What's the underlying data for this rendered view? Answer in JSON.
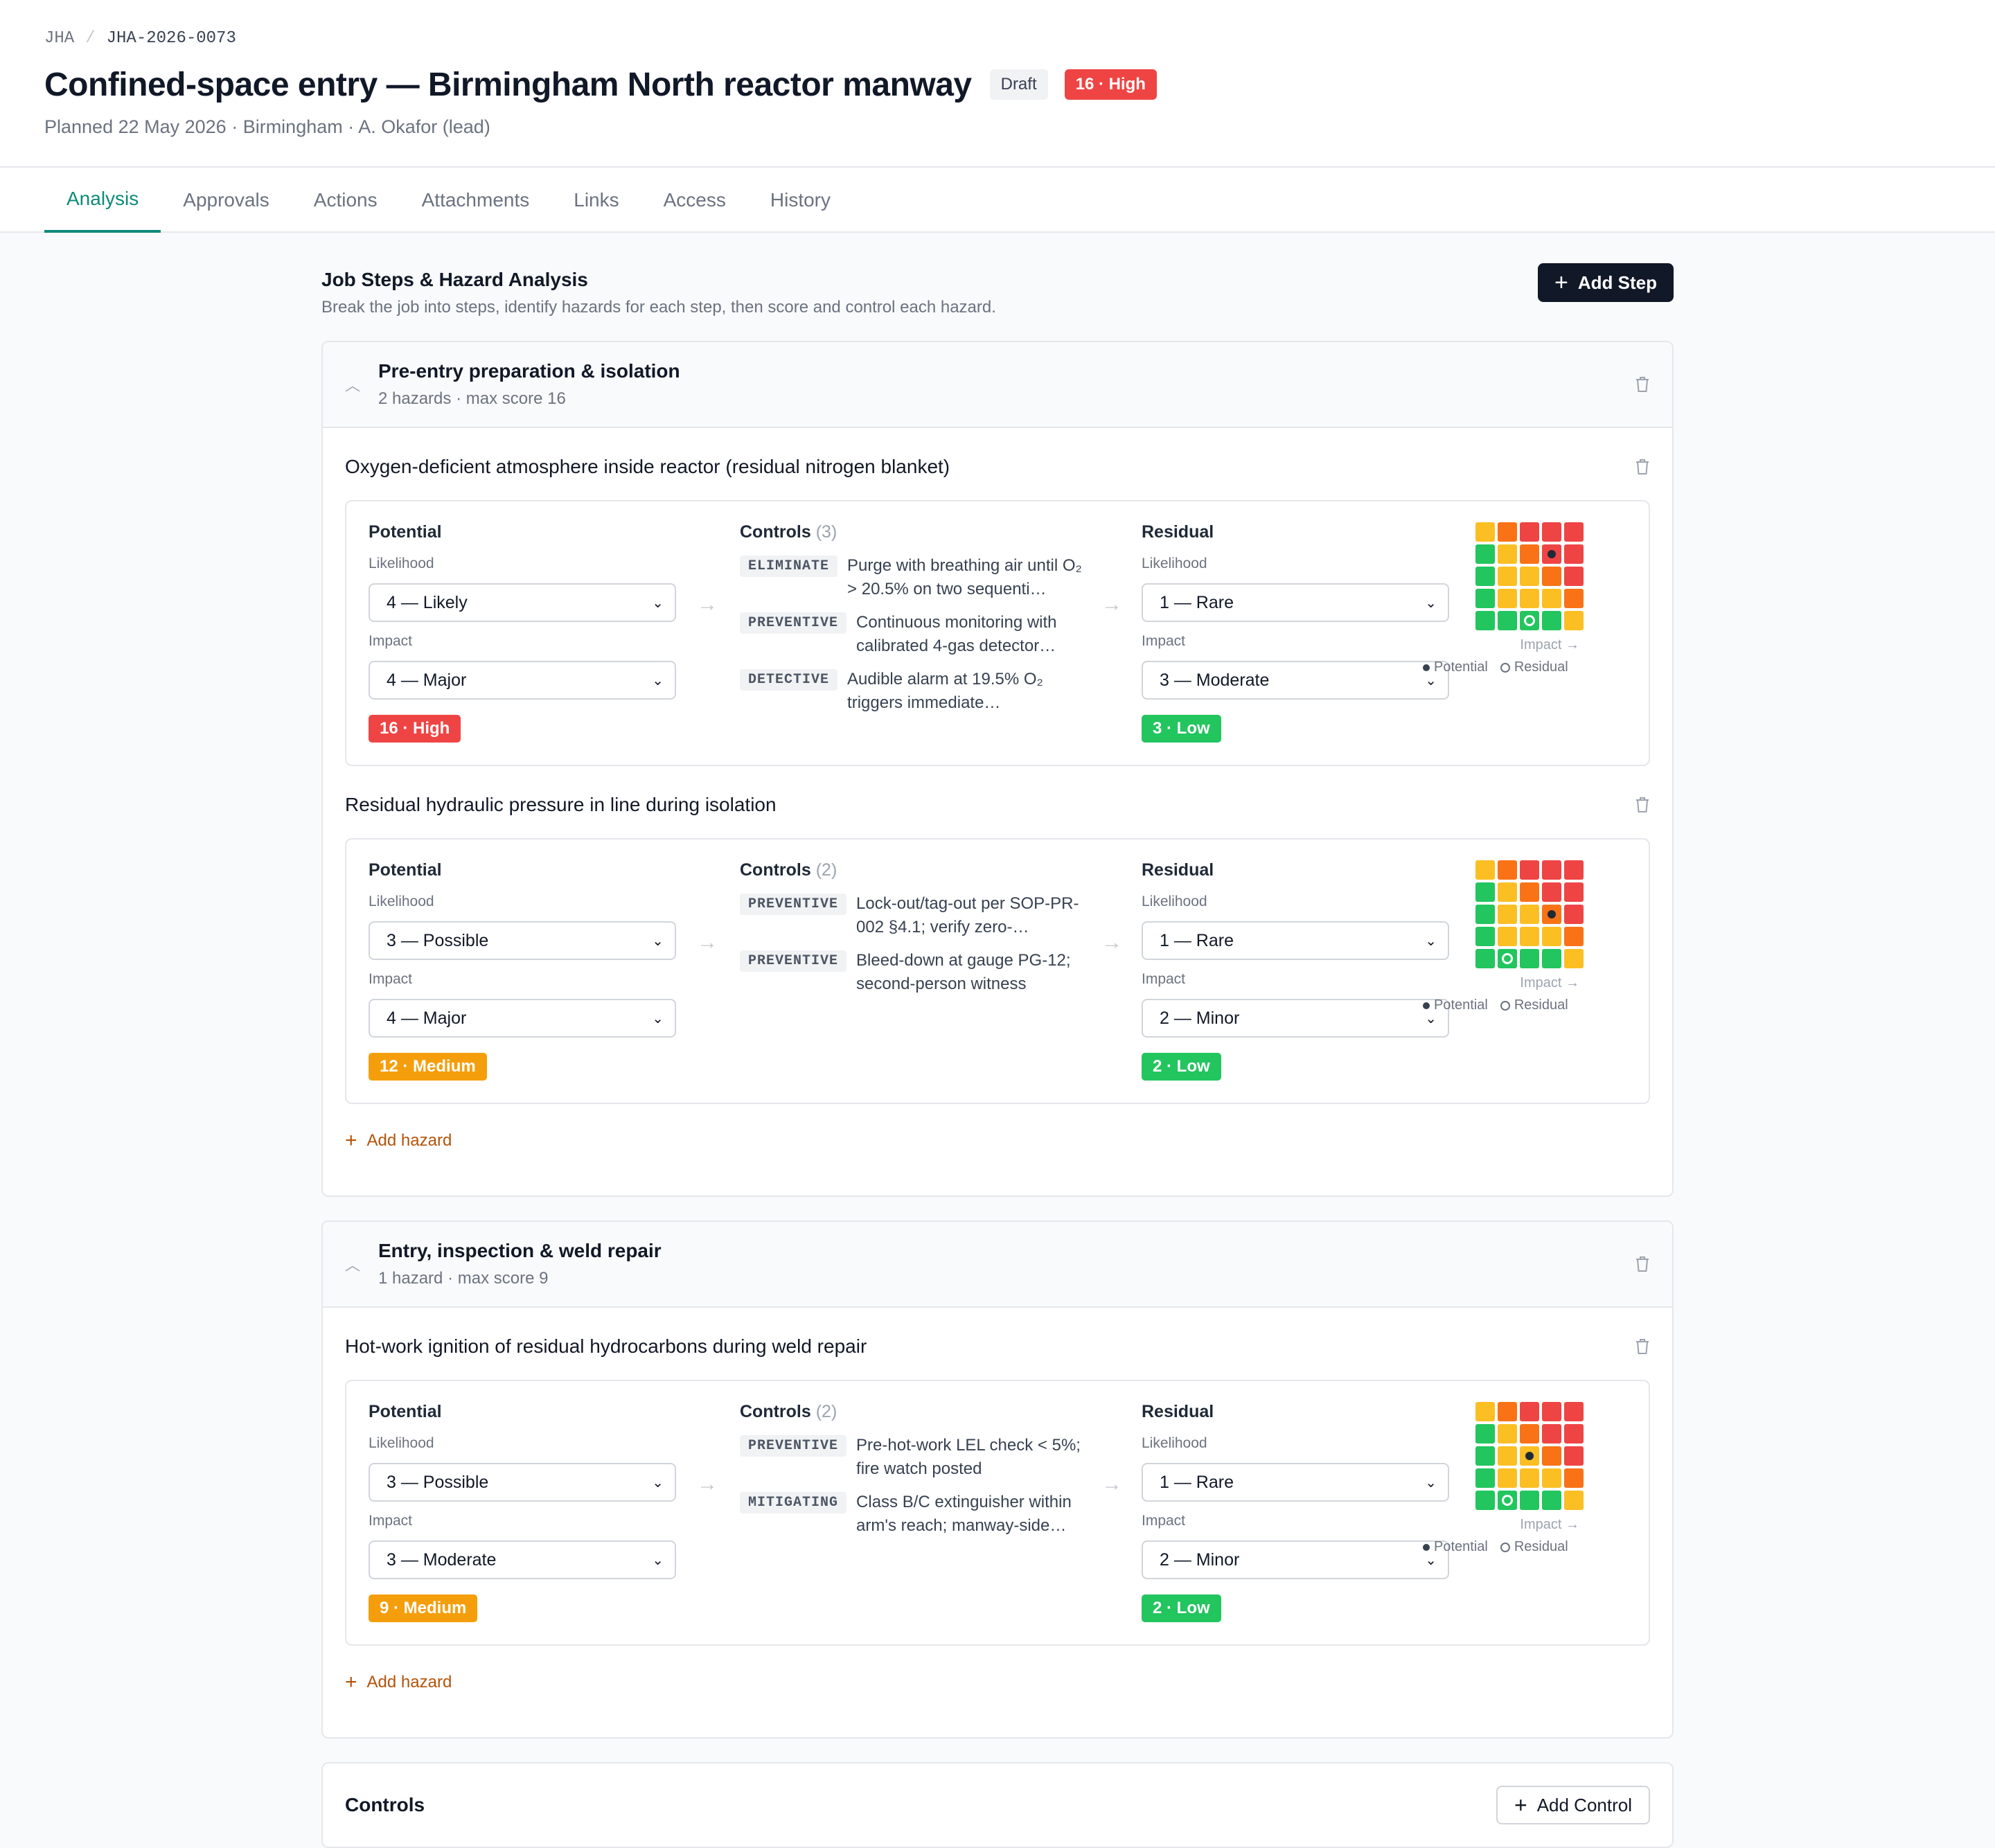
{
  "breadcrumb": {
    "root": "JHA",
    "current": "JHA-2026-0073"
  },
  "header": {
    "title": "Confined-space entry — Birmingham North reactor manway",
    "status": "Draft",
    "risk_badge": "16 · High",
    "subtitle": "Planned 22 May 2026 · Birmingham · A. Okafor (lead)"
  },
  "tabs": [
    "Analysis",
    "Approvals",
    "Actions",
    "Attachments",
    "Links",
    "Access",
    "History"
  ],
  "section": {
    "title": "Job Steps & Hazard Analysis",
    "description": "Break the job into steps, identify hazards for each step, then score and control each hazard.",
    "add_step": "Add Step"
  },
  "labels": {
    "potential": "Potential",
    "controls": "Controls",
    "residual": "Residual",
    "likelihood": "Likelihood",
    "impact": "Impact",
    "matrix_axis": "Impact →",
    "legend_potential": "Potential",
    "legend_residual": "Residual",
    "add_hazard": "Add hazard"
  },
  "colors": {
    "green": "#22c55e",
    "yellow": "#fbbf24",
    "orange": "#f97316",
    "red": "#ef4444",
    "medium": "#f59e0b",
    "accent": "#0f8a78"
  },
  "steps": [
    {
      "title": "Pre-entry preparation & isolation",
      "meta": "2 hazards · max score 16",
      "hazards": [
        {
          "title": "Oxygen-deficient atmosphere inside reactor (residual nitrogen blanket)",
          "potential": {
            "likelihood": "4 — Likely",
            "impact": "4 — Major",
            "score": "16 · High"
          },
          "controls_count": "(3)",
          "controls": [
            {
              "type": "ELIMINATE",
              "text": "Purge with breathing air until O₂ > 20.5% on two sequenti…"
            },
            {
              "type": "PREVENTIVE",
              "text": "Continuous monitoring with calibrated 4-gas detector…"
            },
            {
              "type": "DETECTIVE",
              "text": "Audible alarm at 19.5% O₂ triggers immediate…"
            }
          ],
          "residual": {
            "likelihood": "1 — Rare",
            "impact": "3 — Moderate",
            "score": "3 · Low"
          },
          "matrix": {
            "potential": [
              4,
              4
            ],
            "residual": [
              1,
              3
            ]
          }
        },
        {
          "title": "Residual hydraulic pressure in line during isolation",
          "potential": {
            "likelihood": "3 — Possible",
            "impact": "4 — Major",
            "score": "12 · Medium"
          },
          "controls_count": "(2)",
          "controls": [
            {
              "type": "PREVENTIVE",
              "text": "Lock-out/tag-out per SOP-PR-002 §4.1; verify zero-…"
            },
            {
              "type": "PREVENTIVE",
              "text": "Bleed-down at gauge PG-12; second-person witness"
            }
          ],
          "residual": {
            "likelihood": "1 — Rare",
            "impact": "2 — Minor",
            "score": "2 · Low"
          },
          "matrix": {
            "potential": [
              3,
              4
            ],
            "residual": [
              1,
              2
            ]
          }
        }
      ]
    },
    {
      "title": "Entry, inspection & weld repair",
      "meta": "1 hazard · max score 9",
      "hazards": [
        {
          "title": "Hot-work ignition of residual hydrocarbons during weld repair",
          "potential": {
            "likelihood": "3 — Possible",
            "impact": "3 — Moderate",
            "score": "9 · Medium"
          },
          "controls_count": "(2)",
          "controls": [
            {
              "type": "PREVENTIVE",
              "text": "Pre-hot-work LEL check < 5%; fire watch posted"
            },
            {
              "type": "MITIGATING",
              "text": "Class B/C extinguisher within arm's reach; manway-side…"
            }
          ],
          "residual": {
            "likelihood": "1 — Rare",
            "impact": "2 — Minor",
            "score": "2 · Low"
          },
          "matrix": {
            "potential": [
              3,
              3
            ],
            "residual": [
              1,
              2
            ]
          }
        }
      ]
    }
  ],
  "controls_panel": {
    "title": "Controls",
    "add_control": "Add Control"
  }
}
